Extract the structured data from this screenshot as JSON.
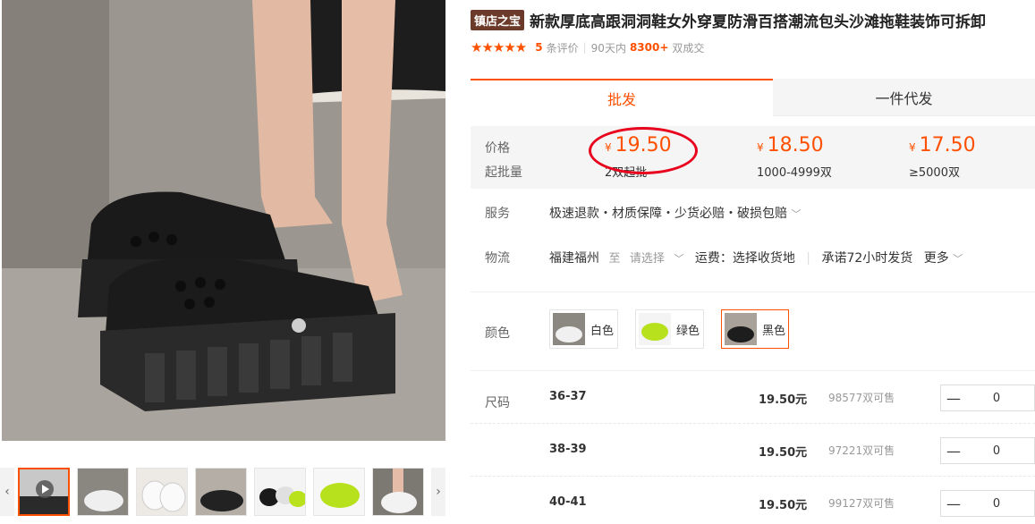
{
  "product": {
    "badge": "镇店之宝",
    "title": "新款厚底高跟洞洞鞋女外穿夏防滑百搭潮流包头沙滩拖鞋装饰可拆卸",
    "rating": {
      "stars": "★★★★★",
      "count": "5",
      "count_label": "条评价",
      "days": "90天内",
      "sold": "8300+",
      "sold_label": "双成交"
    }
  },
  "tabs": [
    {
      "label": "批发"
    },
    {
      "label": "一件代发"
    }
  ],
  "price_box": {
    "price_label": "价格",
    "min_label": "起批量",
    "currency": "¥",
    "tiers": [
      {
        "price": "19.50",
        "qty": "2双起批"
      },
      {
        "price": "18.50",
        "qty": "1000-4999双"
      },
      {
        "price": "17.50",
        "qty": "≥5000双"
      }
    ]
  },
  "service": {
    "label": "服务",
    "text": "极速退款・材质保障・少货必赔・破损包赔"
  },
  "logistics": {
    "label": "物流",
    "from": "福建福州",
    "to": "至",
    "select": "请选择",
    "freight": "运费：选择收货地",
    "promise": "承诺72小时发货",
    "more": "更多"
  },
  "colors": {
    "label": "颜色",
    "options": [
      {
        "name": "白色"
      },
      {
        "name": "绿色"
      },
      {
        "name": "黑色"
      }
    ],
    "selected": "黑色"
  },
  "sizes": {
    "label": "尺码",
    "rows": [
      {
        "size": "36-37",
        "price": "19.50元",
        "stock": "98577双可售",
        "qty": "0"
      },
      {
        "size": "38-39",
        "price": "19.50元",
        "stock": "97221双可售",
        "qty": "0"
      },
      {
        "size": "40-41",
        "price": "19.50元",
        "stock": "99127双可售",
        "qty": "0"
      }
    ]
  },
  "gallery": {
    "prev_arrow": "‹",
    "next_arrow": "›",
    "minus": "—"
  },
  "colors_hex": {
    "accent": "#ff5000",
    "circle": "#e8001c",
    "badge_bg": "#6b3a2a"
  }
}
